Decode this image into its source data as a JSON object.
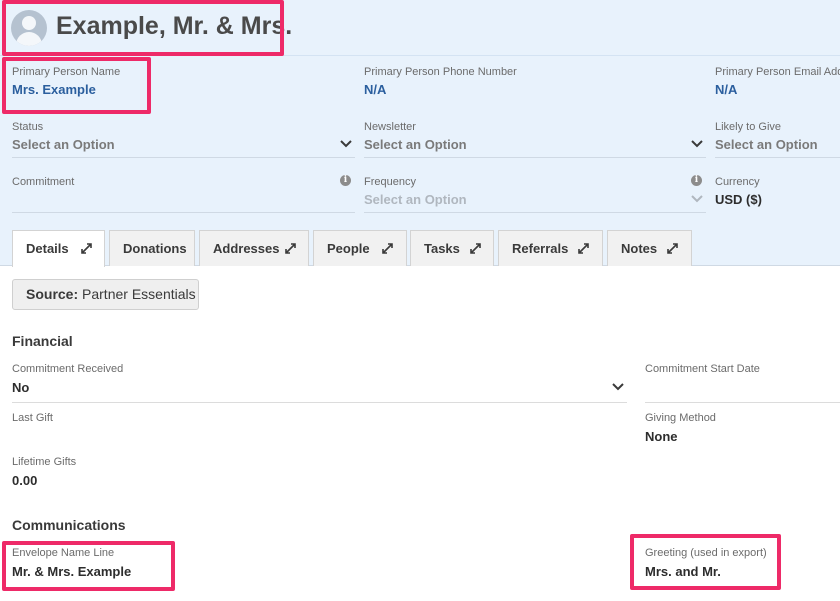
{
  "record": {
    "title": "Example, Mr. & Mrs."
  },
  "header_fields": {
    "primary_person_name": {
      "label": "Primary Person Name",
      "value": "Mrs. Example"
    },
    "primary_person_phone": {
      "label": "Primary Person Phone Number",
      "value": "N/A"
    },
    "primary_person_email": {
      "label": "Primary Person Email Addre",
      "value": "N/A"
    },
    "status": {
      "label": "Status",
      "value": "Select an Option"
    },
    "newsletter": {
      "label": "Newsletter",
      "value": "Select an Option"
    },
    "likely_to_give": {
      "label": "Likely to Give",
      "value": "Select an Option"
    },
    "commitment": {
      "label": "Commitment",
      "value": ""
    },
    "frequency": {
      "label": "Frequency",
      "value": "Select an Option"
    },
    "currency": {
      "label": "Currency",
      "value": "USD ($)"
    }
  },
  "tabs": [
    {
      "label": "Details",
      "expandable": true,
      "active": true
    },
    {
      "label": "Donations",
      "expandable": false,
      "active": false
    },
    {
      "label": "Addresses",
      "expandable": true,
      "active": false
    },
    {
      "label": "People",
      "expandable": true,
      "active": false
    },
    {
      "label": "Tasks",
      "expandable": true,
      "active": false
    },
    {
      "label": "Referrals",
      "expandable": true,
      "active": false
    },
    {
      "label": "Notes",
      "expandable": true,
      "active": false
    }
  ],
  "source": {
    "prefix": "Source:",
    "value": "Partner Essentials"
  },
  "financial": {
    "title": "Financial",
    "commitment_received": {
      "label": "Commitment Received",
      "value": "No"
    },
    "commitment_start_date": {
      "label": "Commitment Start Date",
      "value": ""
    },
    "last_gift": {
      "label": "Last Gift",
      "value": ""
    },
    "giving_method": {
      "label": "Giving Method",
      "value": "None"
    },
    "lifetime_gifts": {
      "label": "Lifetime Gifts",
      "value": "0.00"
    }
  },
  "communications": {
    "title": "Communications",
    "envelope_name_line": {
      "label": "Envelope Name Line",
      "value": "Mr. & Mrs. Example"
    },
    "greeting": {
      "label": "Greeting (used in export)",
      "value": "Mrs. and Mr."
    }
  },
  "icons": {
    "chevron": "chevron-down-icon",
    "info": "info-icon",
    "expand": "expand-icon",
    "avatar": "avatar-icon"
  },
  "colors": {
    "header_bg": "#e8f2fc",
    "link": "#2b5f9e",
    "highlight": "#ee2a68"
  }
}
